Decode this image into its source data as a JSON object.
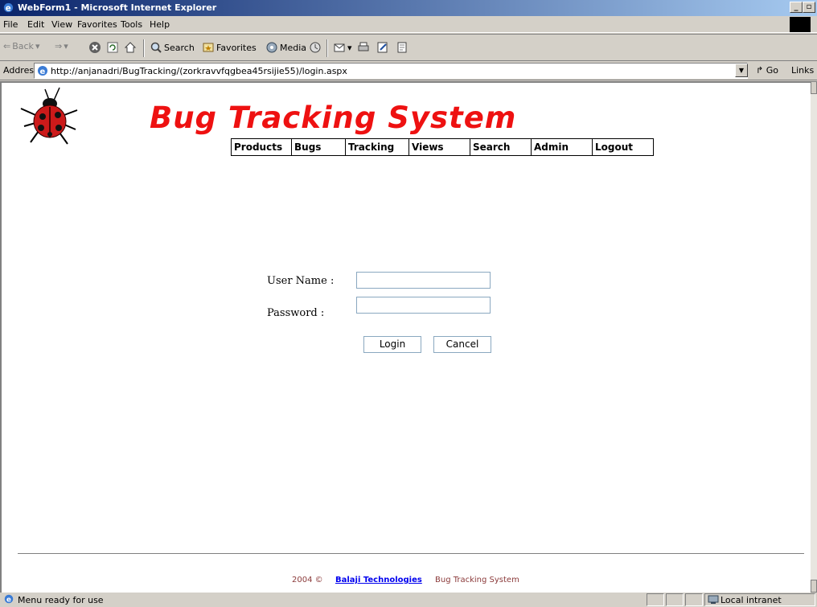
{
  "window": {
    "title": "WebForm1 - Microsoft Internet Explorer"
  },
  "menubar": {
    "items": [
      "File",
      "Edit",
      "View",
      "Favorites",
      "Tools",
      "Help"
    ]
  },
  "toolbar": {
    "back": "Back",
    "search": "Search",
    "favorites": "Favorites",
    "media": "Media"
  },
  "address": {
    "label": "Address",
    "url": "http://anjanadri/BugTracking/(zorkravvfqgbea45rsijie55)/login.aspx",
    "go": "Go",
    "links": "Links"
  },
  "page": {
    "title": "Bug Tracking System",
    "nav": [
      "Products",
      "Bugs",
      "Tracking",
      "Views",
      "Search",
      "Admin",
      "Logout"
    ],
    "login": {
      "username_label": "User Name :",
      "password_label": "Password :",
      "username_value": "",
      "password_value": "",
      "login_button": "Login",
      "cancel_button": "Cancel"
    },
    "footer": {
      "year": "2004 ©",
      "company": "Balaji Technologies",
      "system": "Bug Tracking System"
    }
  },
  "status": {
    "message": "Menu ready for use",
    "zone": "Local intranet"
  },
  "colors": {
    "title_red": "#ee1111",
    "titlebar": "#0a246a",
    "footer_text": "#8b3a3a"
  }
}
